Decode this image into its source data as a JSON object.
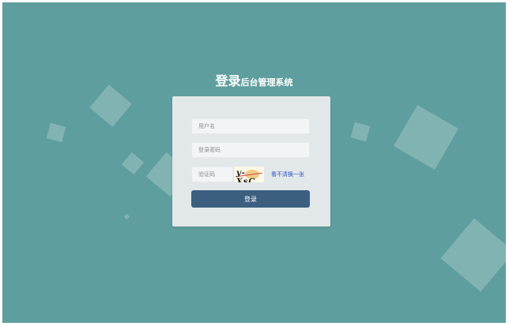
{
  "header": {
    "title_main": "登录",
    "title_sub": "后台管理系统"
  },
  "form": {
    "username_placeholder": "用户名",
    "password_placeholder": "登录密码",
    "captcha_placeholder": "验证码",
    "captcha_image_text": "y-XsC",
    "refresh_link": "看不清换一张",
    "submit_label": "登录"
  },
  "colors": {
    "background": "#5f9e9e",
    "panel": "#e2e7e9",
    "button": "#3c5f80",
    "link": "#2f54c8"
  }
}
